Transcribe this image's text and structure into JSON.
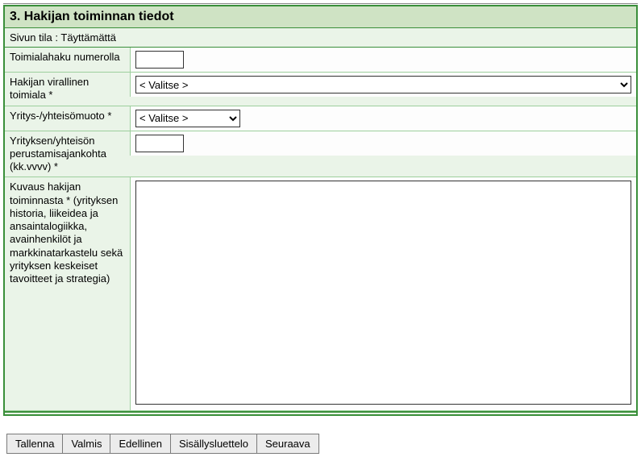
{
  "section": {
    "title": "3. Hakijan toiminnan tiedot"
  },
  "status": {
    "label": "Sivun tila :",
    "value": "Täyttämättä"
  },
  "fields": {
    "toimialahaku": {
      "label": "Toimialahaku numerolla",
      "value": ""
    },
    "virallinen_toimiala": {
      "label": "Hakijan virallinen toimiala *",
      "selected": "< Valitse >"
    },
    "yritysmuoto": {
      "label": "Yritys-/yhteisömuoto *",
      "selected": "< Valitse >"
    },
    "perustamisaika": {
      "label": "Yrityksen/yhteisön perustamisajankohta (kk.vvvv) *",
      "value": ""
    },
    "kuvaus": {
      "label": "Kuvaus hakijan toiminnasta * (yrityksen historia, liikeidea ja ansaintalogiikka, avainhenkilöt ja markkinatarkastelu sekä yrityksen keskeiset tavoitteet ja strategia)",
      "value": ""
    }
  },
  "buttons": {
    "tallenna": "Tallenna",
    "valmis": "Valmis",
    "edellinen": "Edellinen",
    "sisallysluettelo": "Sisällysluettelo",
    "seuraava": "Seuraava"
  }
}
